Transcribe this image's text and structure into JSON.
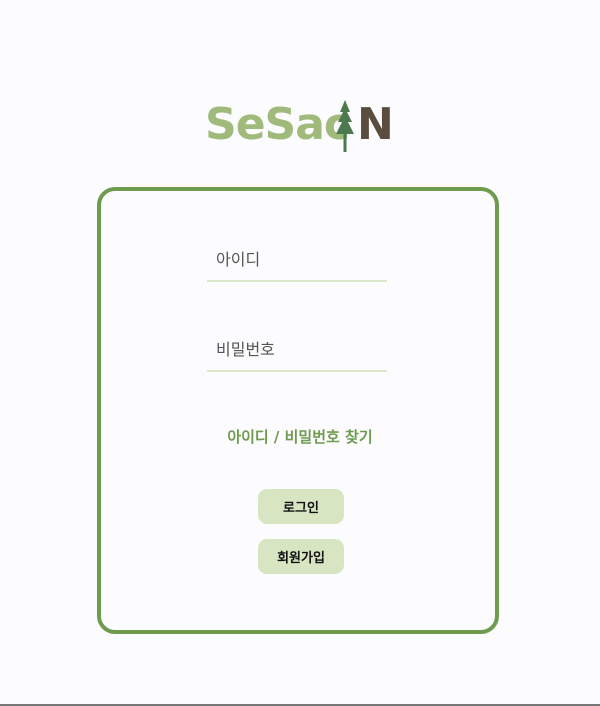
{
  "logo": {
    "text_part1": "SeSac",
    "text_part2": "N",
    "tree_icon": "pine-tree-icon",
    "colors": {
      "sesac": "#a0ba7b",
      "tree": "#4c7a4e",
      "n": "#5a4d40"
    }
  },
  "form": {
    "id_placeholder": "아이디",
    "id_value": "",
    "password_placeholder": "비밀번호",
    "password_value": "",
    "find_link": "아이디 / 비밀번호 찾기",
    "login_label": "로그인",
    "signup_label": "회원가입"
  },
  "colors": {
    "accent": "#6f9b50",
    "button_bg": "#d8e5c3",
    "underline": "#dbe5c8",
    "background": "#fcfbfd"
  }
}
